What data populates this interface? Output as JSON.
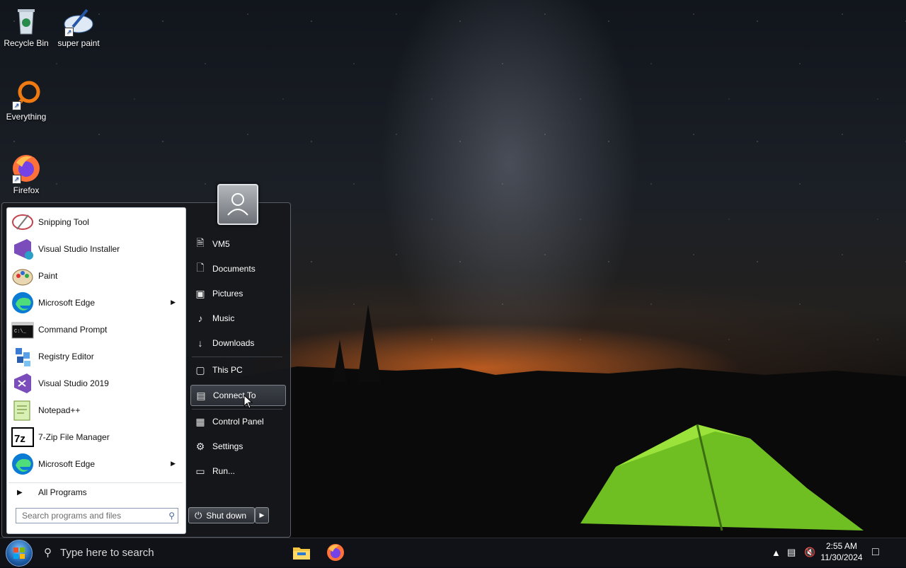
{
  "desktop": {
    "icons": [
      {
        "label": "Recycle Bin",
        "icon": "recycle-bin-icon"
      },
      {
        "label": "super paint",
        "icon": "paint-brush-icon"
      },
      {
        "label": "Everything",
        "icon": "search-loupe-icon"
      },
      {
        "label": "Firefox",
        "icon": "firefox-icon"
      }
    ]
  },
  "start_menu": {
    "programs": [
      {
        "label": "Snipping Tool",
        "icon": "snipping-tool-icon",
        "submenu": false
      },
      {
        "label": "Visual Studio Installer",
        "icon": "vs-installer-icon",
        "submenu": false
      },
      {
        "label": "Paint",
        "icon": "paint-icon",
        "submenu": false
      },
      {
        "label": "Microsoft Edge",
        "icon": "edge-icon",
        "submenu": true
      },
      {
        "label": "Command Prompt",
        "icon": "cmd-icon",
        "submenu": false
      },
      {
        "label": "Registry Editor",
        "icon": "regedit-icon",
        "submenu": false
      },
      {
        "label": "Visual Studio 2019",
        "icon": "visual-studio-icon",
        "submenu": false
      },
      {
        "label": "Notepad++",
        "icon": "notepadpp-icon",
        "submenu": false
      },
      {
        "label": "7-Zip File Manager",
        "icon": "7zip-icon",
        "submenu": false
      },
      {
        "label": "Microsoft Edge",
        "icon": "edge-icon",
        "submenu": true
      }
    ],
    "all_programs": "All Programs",
    "search_placeholder": "Search programs and files",
    "right_items": [
      {
        "label": "VM5",
        "icon": "user-folder-icon"
      },
      {
        "label": "Documents",
        "icon": "document-icon"
      },
      {
        "label": "Pictures",
        "icon": "picture-icon"
      },
      {
        "label": "Music",
        "icon": "music-note-icon"
      },
      {
        "label": "Downloads",
        "icon": "download-arrow-icon"
      },
      {
        "label": "This PC",
        "icon": "monitor-icon"
      },
      {
        "label": "Connect To",
        "icon": "network-connect-icon",
        "highlighted": true
      },
      {
        "label": "Control Panel",
        "icon": "control-panel-icon"
      },
      {
        "label": "Settings",
        "icon": "gear-icon"
      },
      {
        "label": "Run...",
        "icon": "run-icon"
      }
    ],
    "shutdown_label": "Shut down"
  },
  "taskbar": {
    "search_placeholder": "Type here to search",
    "time": "2:55 AM",
    "date": "11/30/2024"
  }
}
